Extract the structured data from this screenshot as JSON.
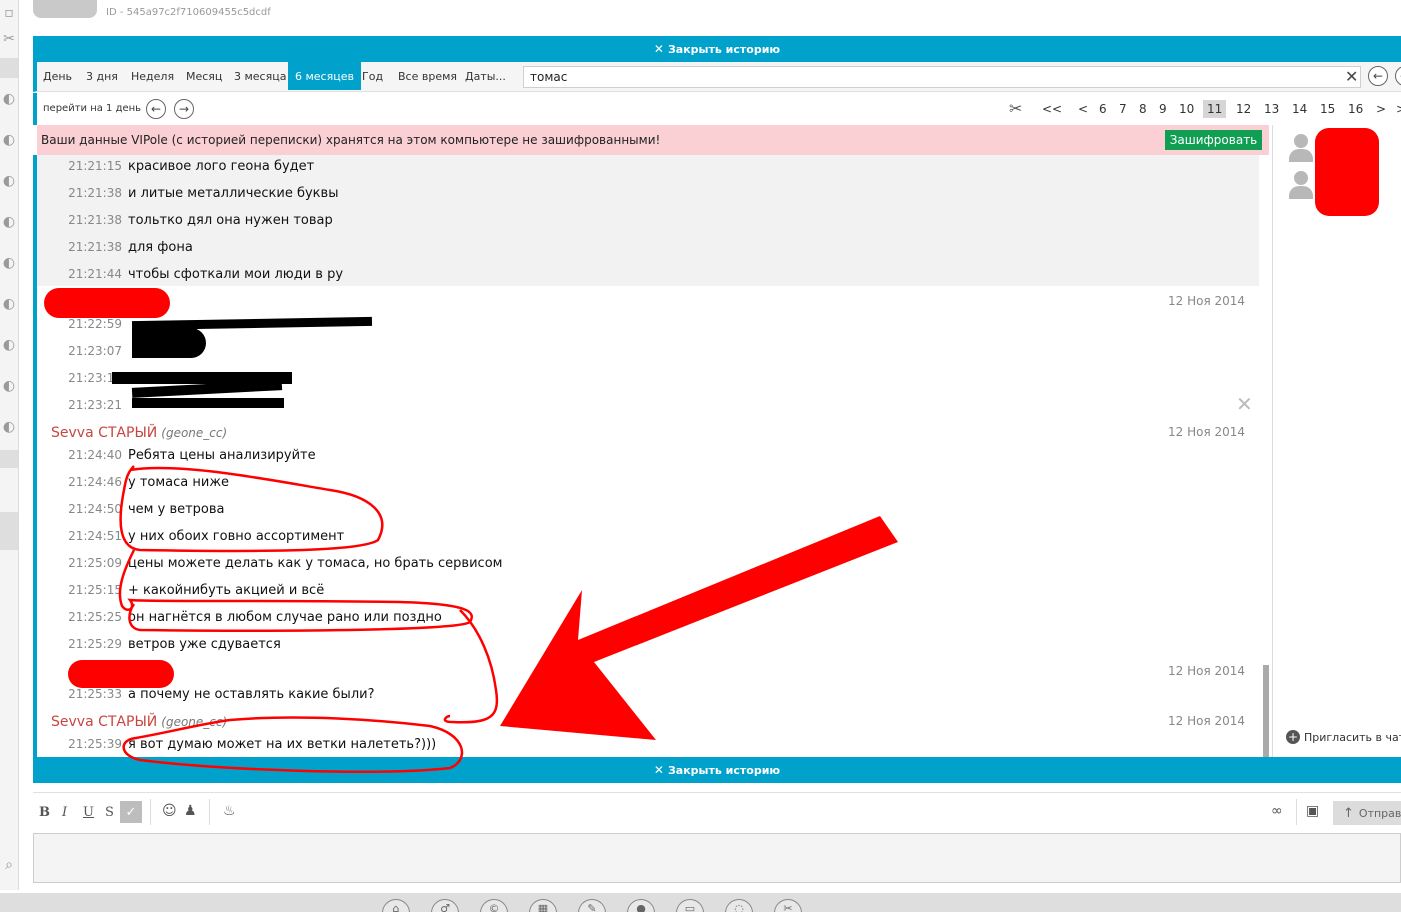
{
  "header": {
    "id_text": "ID - 545a97c2f710609455c5dcdf"
  },
  "history": {
    "close_label": "Закрыть историю",
    "periods": [
      "День",
      "3 дня",
      "Неделя",
      "Месяц",
      "3 месяца",
      "6 месяцев",
      "Год",
      "Все время",
      "Даты..."
    ],
    "active_period": "6 месяцев",
    "search_value": "томас"
  },
  "nav": {
    "goto_label": "перейти на 1 день",
    "pages": [
      "<<",
      "<",
      "6",
      "7",
      "8",
      "9",
      "10",
      "11",
      "12",
      "13",
      "14",
      "15",
      "16",
      ">",
      ">"
    ],
    "active_page": "11"
  },
  "warning": {
    "text": "Ваши данные VIPole (с историей переписки) хранятся на этом компьютере не зашифрованными!",
    "encrypt_label": "Зашифровать"
  },
  "chat": {
    "block1": [
      {
        "time": "21:21:15",
        "text": "красивое лого геона будет"
      },
      {
        "time": "21:21:38",
        "text": "и литые металлические буквы"
      },
      {
        "time": "21:21:38",
        "text": "тольтко дял она нужен товар"
      },
      {
        "time": "21:21:38",
        "text": "для фона"
      },
      {
        "time": "21:21:44",
        "text": "чтобы сфоткали мои люди в ру"
      }
    ],
    "block2_date": "12 Ноя 2014",
    "block2": [
      {
        "time": "21:22:59",
        "text": ""
      },
      {
        "time": "21:23:07",
        "text": ""
      },
      {
        "time": "21:23:15",
        "text": ""
      },
      {
        "time": "21:23:21",
        "text": ""
      }
    ],
    "block3_author": "Sevva СТАРЫЙ",
    "block3_handle": "(geone_cc)",
    "block3_date": "12 Ноя 2014",
    "block3": [
      {
        "time": "21:24:40",
        "text": "Ребята цены анализируйте"
      },
      {
        "time": "21:24:46",
        "text": "у томаса ниже"
      },
      {
        "time": "21:24:50",
        "text": "чем у ветрова"
      },
      {
        "time": "21:24:51",
        "text": "у них обоих говно ассортимент"
      },
      {
        "time": "21:25:09",
        "text": "цены можете делать как у томаса, но брать сервисом"
      },
      {
        "time": "21:25:15",
        "text": "+ какойнибуть акцией и всё"
      },
      {
        "time": "21:25:25",
        "text": "он нагнётся в любом случае рано или поздно"
      },
      {
        "time": "21:25:29",
        "text": "ветров уже сдувается"
      }
    ],
    "block4_date": "12 Ноя 2014",
    "block4": [
      {
        "time": "21:25:33",
        "text": "а почему не оставлять какие были?"
      }
    ],
    "block5_author": "Sevva СТАРЫЙ",
    "block5_handle": "(geone_cc)",
    "block5_date": "12 Ноя 2014",
    "block5": [
      {
        "time": "21:25:39",
        "text": "я вот думаю может на их ветки налететь?)))"
      }
    ]
  },
  "right_panel": {
    "invite_label": "Пригласить в чат..."
  },
  "editor": {
    "bold": "B",
    "italic": "I",
    "underline": "U",
    "strike": "S",
    "send_label": "Отправить"
  },
  "colors": {
    "accent": "#00a2cc",
    "warning_bg": "#fbd0d4",
    "encrypt_bg": "#109f52",
    "author": "#c7463f",
    "annotation": "#ff0000"
  }
}
